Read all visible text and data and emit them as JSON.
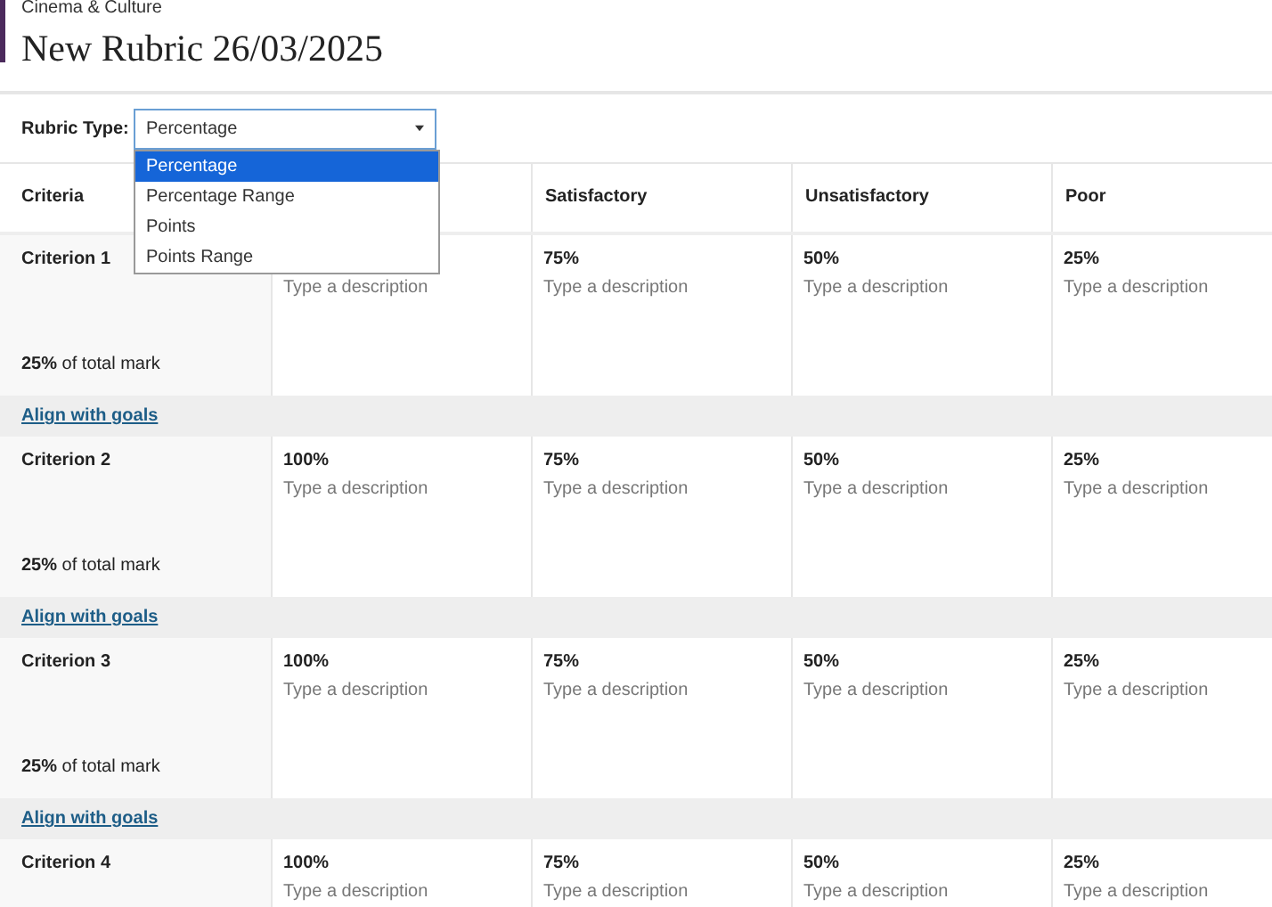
{
  "header": {
    "course": "Cinema & Culture",
    "title": "New Rubric 26/03/2025"
  },
  "rubric_type": {
    "label": "Rubric Type:",
    "value": "Percentage",
    "expanded": true,
    "options": [
      {
        "label": "Percentage",
        "selected": true
      },
      {
        "label": "Percentage Range",
        "selected": false
      },
      {
        "label": "Points",
        "selected": false
      },
      {
        "label": "Points Range",
        "selected": false
      }
    ]
  },
  "table": {
    "criteria_heading": "Criteria",
    "columns": [
      {},
      {
        "label": "Satisfactory"
      },
      {
        "label": "Unsatisfactory"
      },
      {
        "label": "Poor"
      }
    ],
    "rows": [
      {
        "name": "Criterion 1",
        "weight": "25%",
        "weight_text": "of total mark",
        "link": "Align with goals",
        "cells": [
          {
            "description_placeholder": "Type a description"
          },
          {
            "level": "75%",
            "description_placeholder": "Type a description"
          },
          {
            "level": "50%",
            "description_placeholder": "Type a description"
          },
          {
            "level": "25%",
            "description_placeholder": "Type a description"
          }
        ]
      },
      {
        "name": "Criterion 2",
        "weight": "25%",
        "weight_text": "of total mark",
        "link": "Align with goals",
        "cells": [
          {
            "level": "100%",
            "description_placeholder": "Type a description"
          },
          {
            "level": "75%",
            "description_placeholder": "Type a description"
          },
          {
            "level": "50%",
            "description_placeholder": "Type a description"
          },
          {
            "level": "25%",
            "description_placeholder": "Type a description"
          }
        ]
      },
      {
        "name": "Criterion 3",
        "weight": "25%",
        "weight_text": "of total mark",
        "link": "Align with goals",
        "cells": [
          {
            "level": "100%",
            "description_placeholder": "Type a description"
          },
          {
            "level": "75%",
            "description_placeholder": "Type a description"
          },
          {
            "level": "50%",
            "description_placeholder": "Type a description"
          },
          {
            "level": "25%",
            "description_placeholder": "Type a description"
          }
        ]
      },
      {
        "name": "Criterion 4",
        "cells": [
          {
            "level": "100%",
            "description_placeholder": "Type a description"
          },
          {
            "level": "75%",
            "description_placeholder": "Type a description"
          },
          {
            "level": "50%",
            "description_placeholder": "Type a description"
          },
          {
            "level": "25%",
            "description_placeholder": "Type a description"
          }
        ]
      }
    ]
  }
}
